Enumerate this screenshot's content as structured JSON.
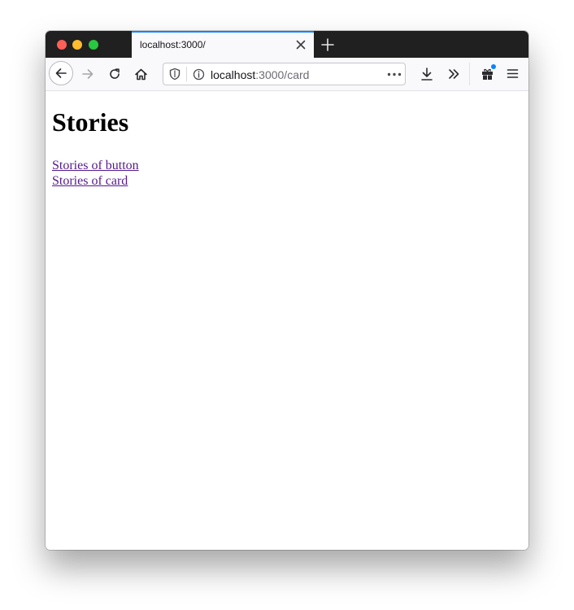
{
  "browser": {
    "tab": {
      "title": "localhost:3000/"
    },
    "url": {
      "host": "localhost",
      "path": ":3000/card"
    }
  },
  "page": {
    "title": "Stories",
    "links": [
      "Stories of button",
      "Stories of card"
    ]
  },
  "colors": {
    "link_visited": "#551a8b",
    "tab_accent": "#0a84ff",
    "tabbar_bg": "#202020"
  },
  "icons": {
    "traffic": [
      "close-window-icon",
      "minimize-window-icon",
      "zoom-window-icon"
    ],
    "nav": [
      "back-arrow-icon",
      "forward-arrow-icon",
      "reload-icon",
      "home-icon"
    ],
    "url": [
      "shield-icon",
      "info-icon",
      "more-dots-icon"
    ],
    "toolbar": [
      "download-icon",
      "overflow-chevrons-icon",
      "extensions-gift-icon",
      "hamburger-menu-icon"
    ]
  }
}
